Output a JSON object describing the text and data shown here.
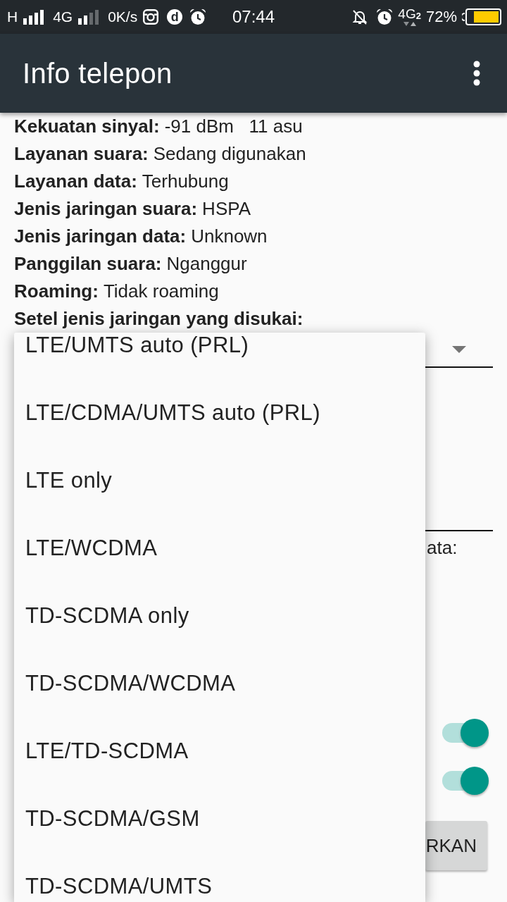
{
  "status_bar": {
    "network_1": "H",
    "network_2": "4G",
    "speed": "0K/s",
    "app_letter": "d",
    "time": "07:44",
    "data_network": "4G",
    "data_sim": "2",
    "battery": "72%"
  },
  "app_bar": {
    "title": "Info telepon"
  },
  "info": [
    {
      "label": "Kekuatan sinyal:",
      "value": "-91 dBm   11 asu"
    },
    {
      "label": "Layanan suara:",
      "value": "Sedang digunakan"
    },
    {
      "label": "Layanan data:",
      "value": "Terhubung"
    },
    {
      "label": "Jenis jaringan suara:",
      "value": "HSPA"
    },
    {
      "label": "Jenis jaringan data:",
      "value": "Unknown"
    },
    {
      "label": "Panggilan suara:",
      "value": "Nganggur"
    },
    {
      "label": "Roaming:",
      "value": "Tidak roaming"
    }
  ],
  "preferred_network": {
    "label": "Setel jenis jaringan yang disukai:"
  },
  "partial_label": "ata:",
  "toggles": [
    {
      "on": true
    },
    {
      "on": true
    }
  ],
  "button": {
    "label": "RKAN"
  },
  "dropdown_menu": {
    "options": [
      "LTE/UMTS auto (PRL)",
      "LTE/CDMA/UMTS auto (PRL)",
      "LTE only",
      "LTE/WCDMA",
      "TD-SCDMA only",
      "TD-SCDMA/WCDMA",
      "LTE/TD-SCDMA",
      "TD-SCDMA/GSM",
      "TD-SCDMA/UMTS"
    ]
  }
}
